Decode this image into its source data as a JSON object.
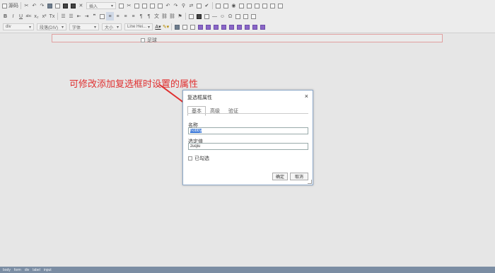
{
  "toolbar": {
    "source_label": "源码",
    "insert_label": "插入",
    "format_select": "段落(DIV)",
    "font_select": "字体",
    "size_select": "大小",
    "lineheight_select": "Line Hei...",
    "tag_select": "div"
  },
  "editor": {
    "checkbox_label": "足球"
  },
  "annotation": {
    "text": "可修改添加复选框时设置的属性",
    "color": "#e03030"
  },
  "dialog": {
    "title": "复选框属性",
    "close": "×",
    "tabs": [
      "基本",
      "高级",
      "验证"
    ],
    "name_label": "名称",
    "name_value": "hobby",
    "value_label": "选定值",
    "value_value": "zuqiu",
    "checked_label": "已勾选",
    "ok": "确定",
    "cancel": "取消"
  },
  "statusbar": {
    "crumbs": [
      "body",
      "form",
      "div",
      "label",
      "input"
    ]
  }
}
